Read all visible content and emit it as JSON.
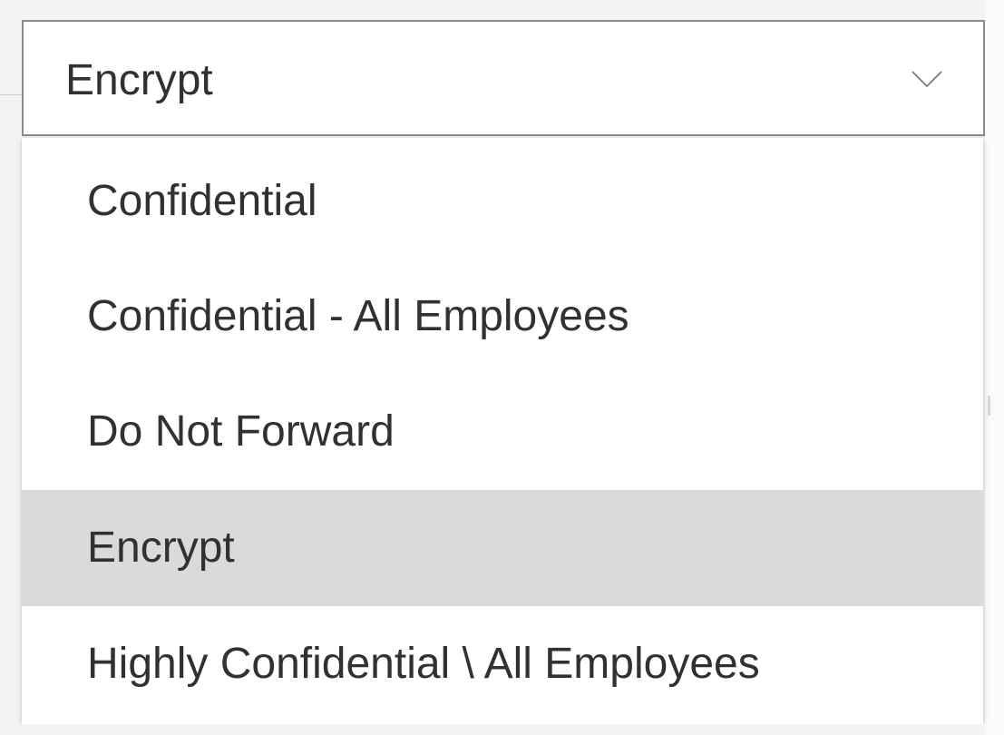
{
  "dropdown": {
    "selected_value": "Encrypt",
    "chevron_icon": "chevron-down-icon"
  },
  "options": [
    {
      "label": "Confidential",
      "selected": false
    },
    {
      "label": "Confidential - All Employees",
      "selected": false
    },
    {
      "label": "Do Not Forward",
      "selected": false
    },
    {
      "label": "Encrypt",
      "selected": true
    },
    {
      "label": "Highly Confidential \\ All Employees",
      "selected": false
    }
  ],
  "colors": {
    "selected_background": "#dadada",
    "text": "#323130",
    "border": "#8a8a8a"
  }
}
